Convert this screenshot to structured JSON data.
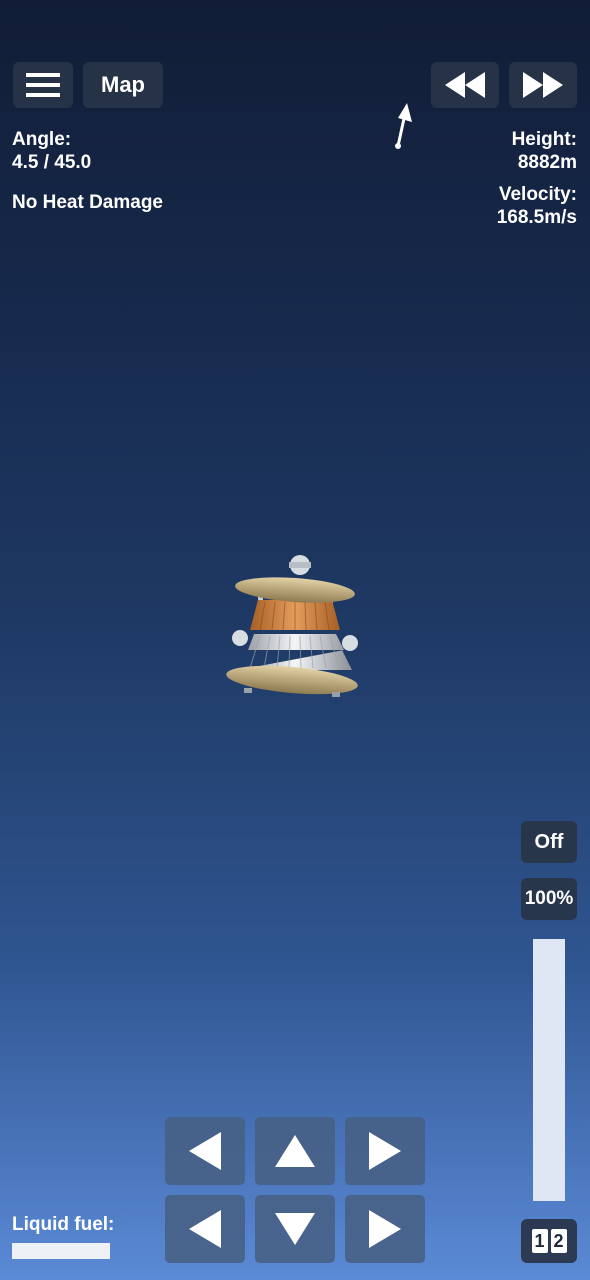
{
  "top_bar": {
    "menu_icon": "hamburger-icon",
    "map_label": "Map",
    "rewind_icon": "rewind-icon",
    "fast_forward_icon": "fast-forward-icon"
  },
  "telemetry": {
    "angle_label": "Angle:",
    "angle_value": "4.5 / 45.0",
    "heat_status": "No Heat Damage",
    "height_label": "Height:",
    "height_value": "8882m",
    "velocity_label": "Velocity:",
    "velocity_value": "168.5m/s"
  },
  "throttle": {
    "toggle_label": "Off",
    "percent_label": "100%",
    "level": 1.0
  },
  "stage_switch": {
    "left": "1",
    "right": "2"
  },
  "controls": {
    "icons": [
      "left-arrow-icon",
      "up-arrow-icon",
      "right-arrow-icon",
      "left-arrow-icon",
      "down-arrow-icon",
      "right-arrow-icon"
    ]
  },
  "fuel": {
    "label": "Liquid fuel:",
    "level": 1.0
  },
  "colors": {
    "sky_top": "#111d36",
    "sky_bottom": "#5b8ad6",
    "button_bg": "#283448",
    "control_bg": "#465f82"
  }
}
